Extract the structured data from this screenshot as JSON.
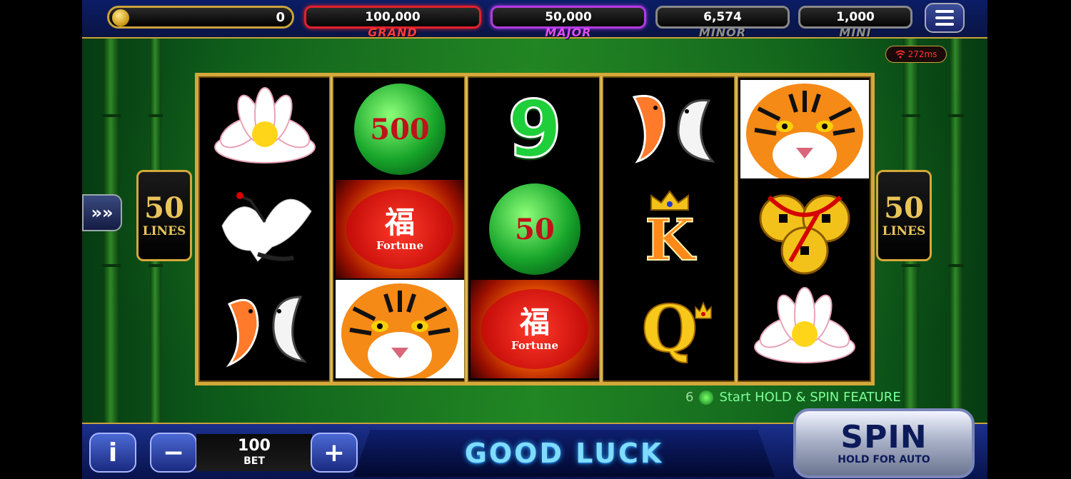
{
  "balance": {
    "value": "0",
    "icon": "coin-icon"
  },
  "jackpots": [
    {
      "id": "grand",
      "value": "100,000",
      "label": "GRAND",
      "border": "#e0212b",
      "label_color": "#ff3b3b"
    },
    {
      "id": "major",
      "value": "50,000",
      "label": "MAJOR",
      "border": "#b23be0",
      "label_color": "#e04dff"
    },
    {
      "id": "minor",
      "value": "6,574",
      "label": "MINOR",
      "border": "#8a8a8a",
      "label_color": "#9a9a9a"
    },
    {
      "id": "mini",
      "value": "1,000",
      "label": "MINI",
      "border": "#8a8a8a",
      "label_color": "#9a9a9a"
    }
  ],
  "ping": "272ms",
  "paylines": {
    "number": "50",
    "label": "LINES"
  },
  "reels": [
    [
      "lotus",
      "crane",
      "koi"
    ],
    [
      "jade-500",
      "lantern",
      "tiger"
    ],
    [
      "nine",
      "jade-50",
      "lantern"
    ],
    [
      "koi",
      "king",
      "queen"
    ],
    [
      "tiger",
      "coins",
      "lotus"
    ]
  ],
  "symbols": {
    "jade_500": "500",
    "jade_50": "50",
    "nine": "9",
    "king": "K",
    "queen": "Q",
    "lantern_char": "福",
    "lantern_text": "Fortune"
  },
  "feature": {
    "count": "6",
    "text": "Start HOLD & SPIN FEATURE"
  },
  "bet": {
    "value": "100",
    "label": "BET",
    "minus": "−",
    "plus": "+"
  },
  "info_label": "i",
  "message": "GOOD LUCK",
  "spin": {
    "label": "SPIN",
    "sublabel": "HOLD FOR AUTO"
  },
  "arrow_label": "»»"
}
